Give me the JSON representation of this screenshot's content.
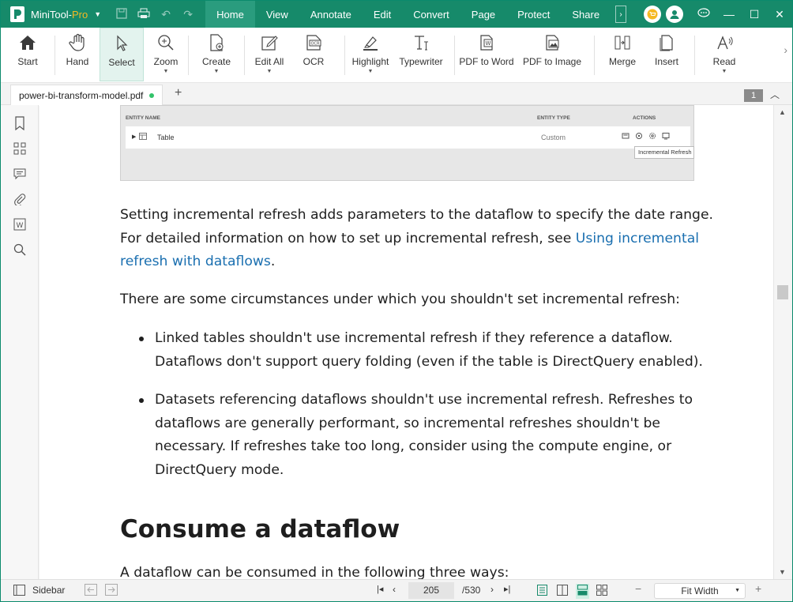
{
  "app": {
    "name": "MiniTool-",
    "name_suffix": "Pro"
  },
  "menu": [
    "Home",
    "View",
    "Annotate",
    "Edit",
    "Convert",
    "Page",
    "Protect",
    "Share"
  ],
  "ribbon": {
    "start": "Start",
    "hand": "Hand",
    "select": "Select",
    "zoom": "Zoom",
    "create": "Create",
    "edit_all": "Edit All",
    "ocr": "OCR",
    "highlight": "Highlight",
    "typewriter": "Typewriter",
    "pdf_to_word": "PDF to Word",
    "pdf_to_image": "PDF to Image",
    "merge": "Merge",
    "insert": "Insert",
    "read": "Read"
  },
  "tab": {
    "filename": "power-bi-transform-model.pdf",
    "page_badge": "1"
  },
  "embed": {
    "col_entity_name": "ENTITY NAME",
    "col_entity_type": "ENTITY TYPE",
    "col_actions": "ACTIONS",
    "row_name": "Table",
    "row_type": "Custom",
    "tooltip": "Incremental Refresh"
  },
  "content": {
    "p1_line1": "Setting incremental refresh adds parameters to the dataflow to specify the date range.",
    "p1_line2": "For detailed information on how to set up incremental refresh, see ",
    "p1_link1": "Using incremental",
    "p1_link2": "refresh with dataflows",
    "p1_end": ".",
    "p2": "There are some circumstances under which you shouldn't set incremental refresh:",
    "b1_l1": "Linked tables shouldn't use incremental refresh if they reference a dataflow.",
    "b1_l2": "Dataflows don't support query folding (even if the table is DirectQuery enabled).",
    "b2_l1": "Datasets referencing dataflows shouldn't use incremental refresh. Refreshes to",
    "b2_l2": "dataflows are generally performant, so incremental refreshes shouldn't be",
    "b2_l3": "necessary. If refreshes take too long, consider using the compute engine, or",
    "b2_l4": "DirectQuery mode.",
    "heading": "Consume a dataflow",
    "p3": "A dataflow can be consumed in the following three ways:"
  },
  "status": {
    "sidebar": "Sidebar",
    "current_page": "205",
    "total_pages": "/530",
    "zoom": "Fit Width"
  },
  "colors": {
    "brand": "#168a6a",
    "link": "#1a6fb0",
    "pro": "#f5b922"
  }
}
